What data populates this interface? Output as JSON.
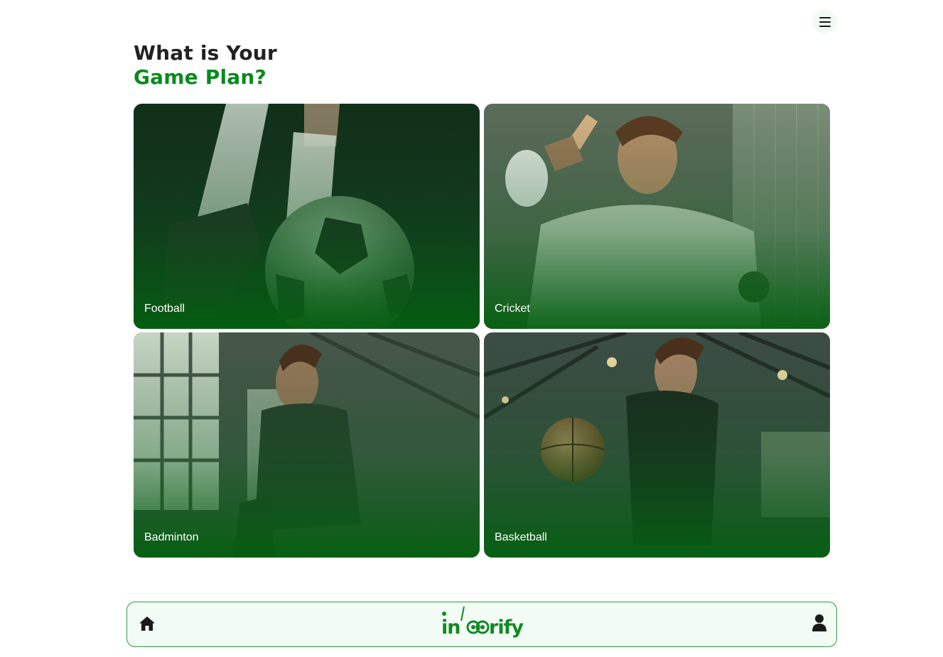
{
  "header": {
    "menu_icon": "hamburger-menu-icon",
    "title_line1": "What is Your",
    "title_line2": "Game Plan?",
    "accent_color": "#0a8a1e"
  },
  "sports": [
    {
      "label": "Football",
      "image": "football-player-kicking-ball"
    },
    {
      "label": "Cricket",
      "image": "cricket-batsman-swinging-bat"
    },
    {
      "label": "Badminton",
      "image": "badminton-player-in-hall"
    },
    {
      "label": "Basketball",
      "image": "basketball-player-dribbling"
    }
  ],
  "bottom_nav": {
    "home_icon": "home-icon",
    "logo_text": "indoorify",
    "profile_icon": "user-icon",
    "border_color": "#2e9a45",
    "background": "#f3fcf4"
  }
}
